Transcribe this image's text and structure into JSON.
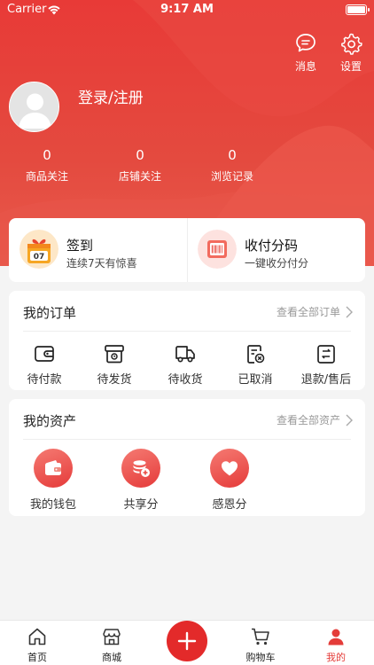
{
  "status": {
    "carrier": "Carrier",
    "time": "9:17 AM"
  },
  "header": {
    "messages_label": "消息",
    "settings_label": "设置",
    "login_label": "登录/注册",
    "stats": [
      {
        "value": "0",
        "label": "商品关注"
      },
      {
        "value": "0",
        "label": "店铺关注"
      },
      {
        "value": "0",
        "label": "浏览记录"
      }
    ]
  },
  "quick": {
    "checkin": {
      "title": "签到",
      "subtitle": "连续7天有惊喜",
      "badge": "07"
    },
    "payment": {
      "title": "收付分码",
      "subtitle": "一键收分付分"
    }
  },
  "orders": {
    "title": "我的订单",
    "more": "查看全部订单",
    "items": [
      {
        "label": "待付款",
        "icon": "wallet-icon"
      },
      {
        "label": "待发货",
        "icon": "box-icon"
      },
      {
        "label": "待收货",
        "icon": "truck-icon"
      },
      {
        "label": "已取消",
        "icon": "cancel-icon"
      },
      {
        "label": "退款/售后",
        "icon": "refund-icon"
      }
    ]
  },
  "assets": {
    "title": "我的资产",
    "more": "查看全部资产",
    "items": [
      {
        "label": "我的钱包",
        "icon": "wallet-icon"
      },
      {
        "label": "共享分",
        "icon": "coins-icon"
      },
      {
        "label": "感恩分",
        "icon": "heart-icon"
      }
    ]
  },
  "tabbar": {
    "items": [
      {
        "label": "首页",
        "icon": "home-icon"
      },
      {
        "label": "商城",
        "icon": "shop-icon"
      },
      {
        "label": "购物车",
        "icon": "cart-icon"
      },
      {
        "label": "我的",
        "icon": "user-icon"
      }
    ],
    "active": "我的"
  },
  "colors": {
    "primary": "#e83a37",
    "background": "#f4f4f4"
  }
}
